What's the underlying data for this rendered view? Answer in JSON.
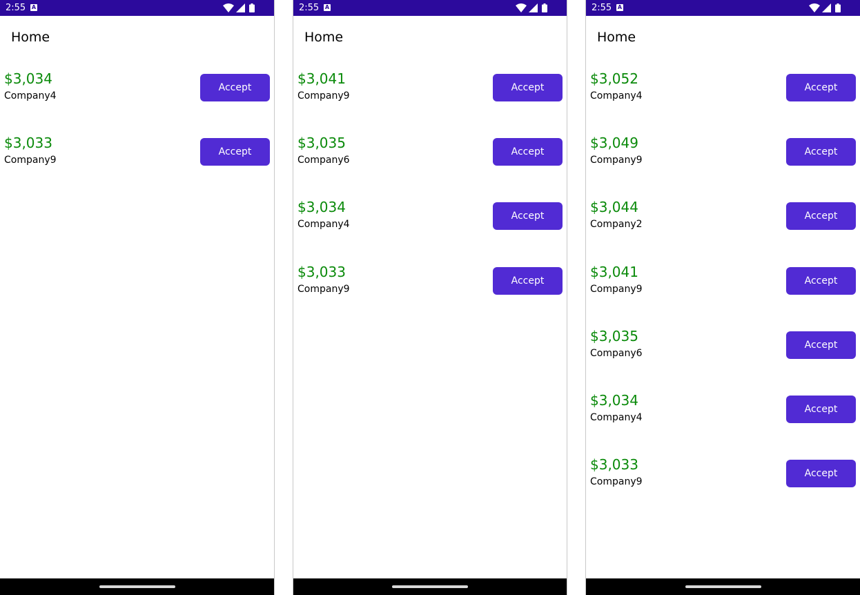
{
  "screens": [
    {
      "status_time": "2:55",
      "title": "Home",
      "offers": [
        {
          "amount": "$3,034",
          "company": "Company4",
          "action": "Accept"
        },
        {
          "amount": "$3,033",
          "company": "Company9",
          "action": "Accept"
        }
      ]
    },
    {
      "status_time": "2:55",
      "title": "Home",
      "offers": [
        {
          "amount": "$3,041",
          "company": "Company9",
          "action": "Accept"
        },
        {
          "amount": "$3,035",
          "company": "Company6",
          "action": "Accept"
        },
        {
          "amount": "$3,034",
          "company": "Company4",
          "action": "Accept"
        },
        {
          "amount": "$3,033",
          "company": "Company9",
          "action": "Accept"
        }
      ]
    },
    {
      "status_time": "2:55",
      "title": "Home",
      "offers": [
        {
          "amount": "$3,052",
          "company": "Company4",
          "action": "Accept"
        },
        {
          "amount": "$3,049",
          "company": "Company9",
          "action": "Accept"
        },
        {
          "amount": "$3,044",
          "company": "Company2",
          "action": "Accept"
        },
        {
          "amount": "$3,041",
          "company": "Company9",
          "action": "Accept"
        },
        {
          "amount": "$3,035",
          "company": "Company6",
          "action": "Accept"
        },
        {
          "amount": "$3,034",
          "company": "Company4",
          "action": "Accept"
        },
        {
          "amount": "$3,033",
          "company": "Company9",
          "action": "Accept"
        }
      ]
    }
  ],
  "icons": {
    "notification": "android-notification-icon",
    "wifi": "wifi-icon",
    "signal": "cellular-signal-icon",
    "battery": "battery-icon"
  },
  "colors": {
    "status_bar": "#2c0a9c",
    "button": "#512bd4",
    "amount_text": "#0a8a0a",
    "nav_bar": "#000000"
  }
}
